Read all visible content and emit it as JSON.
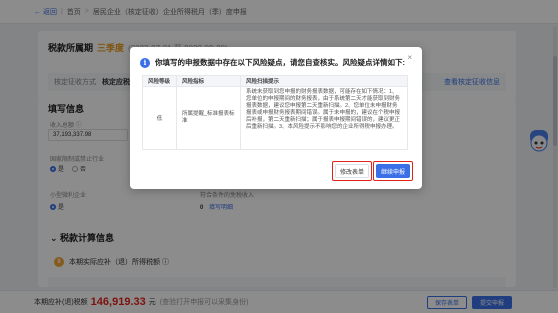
{
  "topbar": {
    "back": "← 返回",
    "crumbs": [
      "首页",
      "居民企业（核定征收）企业所得税月（季）度申报"
    ]
  },
  "period": {
    "label": "税款所属期",
    "tag": "三季度",
    "range": "(2023-07-01 至 2023-09-30)",
    "row_label": "核定征收方式",
    "row_value": "核定应税所得率",
    "row_link": "查看核定征收信息"
  },
  "fill": {
    "title": "填写信息",
    "revenue_label": "收入总额 ⓘ",
    "revenue_value": "37,193,337.98",
    "small_label": "国家限制或禁止行业",
    "radio_yes": "是",
    "radio_no": "否",
    "micro_label": "小型微利企业",
    "right_label": "符合条件的免税收入",
    "right_value": "0",
    "right_link": "填写明细"
  },
  "calc": {
    "title": "税款计算信息",
    "sub": "本期实际应补（退）所得税额 ⓘ",
    "coin": "¥"
  },
  "bottom": {
    "prefix": "本期应补(退)税额",
    "amount": "146,919.33",
    "unit": "元",
    "hint": "(查验打开申报可以采集身份)",
    "btn_save": "保存表单",
    "btn_submit": "提交申报"
  },
  "modal": {
    "title": "你填写的申报数据中存在以下风险疑点，请您自查核实。风险疑点详情如下:",
    "close": "×",
    "headers": [
      "风险等级",
      "风险指标",
      "风险扫描提示"
    ],
    "row": {
      "level": "低",
      "indicator": "所属提醒_标准报表标准",
      "tip": "系统未获取到您申报的财务报表数据，可能存在如下情况：1、您单位的申报期间的财务报表，由于系统第二天才能获取到财务报表数据，建议您申报第二天重新扫描。2、您单位未申报财务报表或申报财务报表期间错误。属于未申报的，建议在个税申报后补报，第二天重新扫描；属于报表申报期间错误的，建议更正后重新扫描。3、本风险提示不影响您的企业所得税申报办理。"
    },
    "btn_modify": "修改表单",
    "btn_continue": "继续申报"
  },
  "colors": {
    "primary": "#3a6fe8",
    "danger": "#e2231a",
    "warn": "#e99a1a"
  }
}
